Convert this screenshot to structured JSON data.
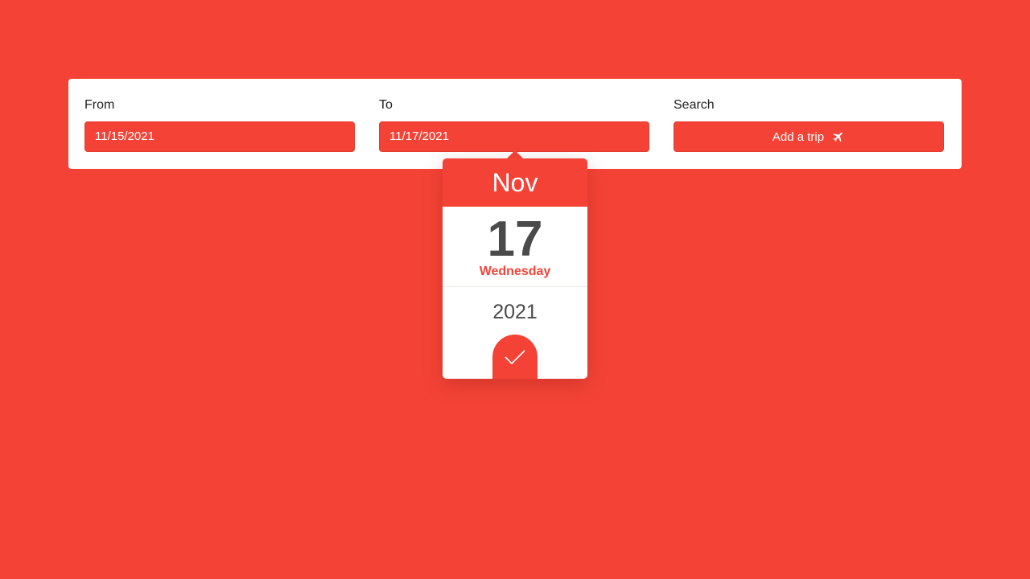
{
  "form": {
    "from": {
      "label": "From",
      "value": "11/15/2021"
    },
    "to": {
      "label": "To",
      "value": "11/17/2021"
    },
    "search": {
      "label": "Search",
      "button_label": "Add a trip",
      "button_icon": "airplane-icon"
    }
  },
  "datepicker": {
    "month": "Nov",
    "day": "17",
    "weekday": "Wednesday",
    "year": "2021",
    "confirm_icon": "checkmark-icon"
  },
  "colors": {
    "accent": "#f44336",
    "panel": "#ffffff",
    "text_dark": "#4a4a4a"
  }
}
